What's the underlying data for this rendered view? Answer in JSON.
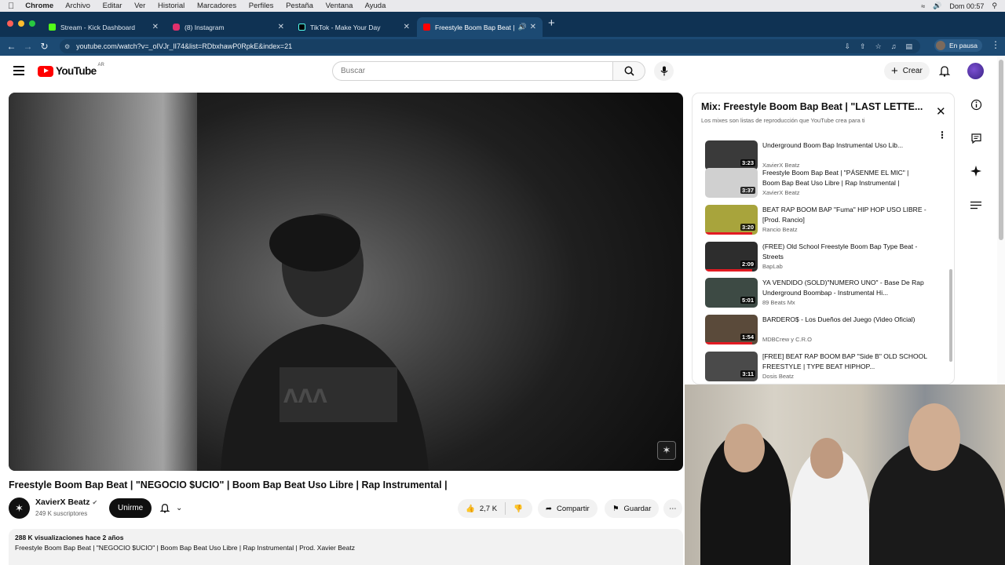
{
  "mac_menu": {
    "app": "Chrome",
    "items": [
      "Archivo",
      "Editar",
      "Ver",
      "Historial",
      "Marcadores",
      "Perfiles",
      "Pestaña",
      "Ventana",
      "Ayuda"
    ],
    "clock": "Dom 00:57"
  },
  "tabs": [
    {
      "label": "Stream - Kick Dashboard",
      "color": "#53fc18"
    },
    {
      "label": "(8) Instagram",
      "color": "#e1306c"
    },
    {
      "label": "TikTok - Make Your Day",
      "color": "#000000"
    },
    {
      "label": "Freestyle Boom Bap Beat |",
      "color": "#ff0000"
    }
  ],
  "address": {
    "url": "youtube.com/watch?v=_oIVJr_lI74&list=RDbxhawP0RpkE&index=21",
    "pause_label": "En pausa"
  },
  "header": {
    "logo_text": "YouTube",
    "region": "AR",
    "search_placeholder": "Buscar",
    "create_label": "Crear"
  },
  "video": {
    "title": "Freestyle Boom Bap Beat | \"NEGOCIO $UCIO\" | Boom Bap Beat Uso Libre | Rap Instrumental |",
    "channel": "XavierX Beatz",
    "subscribers": "249 K suscriptores",
    "join_label": "Unirme",
    "likes": "2,7 K",
    "share_label": "Compartir",
    "save_label": "Guardar",
    "stats": "288 K visualizaciones  hace 2 años",
    "description": "Freestyle Boom Bap Beat | \"NEGOCIO $UCIO\" | Boom Bap Beat Uso Libre | Rap Instrumental | Prod. Xavier Beatz"
  },
  "playlist": {
    "title": "Mix: Freestyle Boom Bap Beat | \"LAST LETTE...",
    "subtitle": "Los mixes son listas de reproducción que YouTube crea para ti",
    "items": [
      {
        "title": "Underground Boom Bap Instrumental Uso Lib...",
        "channel": "XavierX Beatz",
        "duration": "3:23",
        "thumb": "#3a3a3a",
        "progress": 0.0
      },
      {
        "title": "Freestyle Boom Bap Beat | \"PÁSENME EL MIC\" | Boom Bap Beat Uso Libre | Rap Instrumental |",
        "channel": "XavierX Beatz",
        "duration": "3:37",
        "thumb": "#d0d0d0",
        "progress": 0.0
      },
      {
        "title": "BEAT RAP BOOM BAP \"Fuma\" HIP HOP USO LIBRE - [Prod. Rancio]",
        "channel": "Rancio Beatz",
        "duration": "3:20",
        "thumb": "#a8a43c",
        "progress": 0.9
      },
      {
        "title": "(FREE) Old School Freestyle Boom Bap Type Beat - Streets",
        "channel": "BapLab",
        "duration": "2:09",
        "thumb": "#2d2d2d",
        "progress": 0.9
      },
      {
        "title": "YA VENDIDO (SOLD)\"NUMERO UNO\" - Base De Rap Underground Boombap - Instrumental Hi...",
        "channel": "89 Beats Mx",
        "duration": "5:01",
        "thumb": "#3d4a44",
        "progress": 0.0
      },
      {
        "title": "BARDERO$ - Los Dueños del Juego (Video Oficial)",
        "channel": "MDBCrew y C.R.O",
        "duration": "1:54",
        "thumb": "#5a4a3a",
        "progress": 0.9
      },
      {
        "title": "[FREE] BEAT RAP BOOM BAP \"Side B\" OLD SCHOOL FREESTYLE | TYPE BEAT HIPHOP...",
        "channel": "Dosis Beatz",
        "duration": "3:11",
        "thumb": "#4a4a4a",
        "progress": 0.0
      }
    ]
  },
  "colors": {
    "tabstrip": "#0f3253",
    "toolbar": "#1c4a73",
    "youtube_red": "#ff0000"
  }
}
